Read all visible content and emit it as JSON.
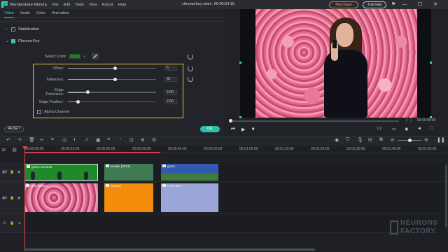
{
  "titlebar": {
    "app_name": "Wondershare Filmora",
    "menus": [
      "File",
      "Edit",
      "Tools",
      "View",
      "Export",
      "Help"
    ],
    "doc_title": "chroma-key-start : 00:00:54:15",
    "purchase_label": "Purchase",
    "tutorials_label": "Tutorials",
    "minimize": "—",
    "maximize": "☐",
    "close": "✕"
  },
  "editor": {
    "tabs": [
      "Video",
      "Audio",
      "Color",
      "Animation"
    ],
    "active_tab": "Video",
    "stabilization_label": "Stabilization",
    "chroma_key_label": "Chroma Key",
    "chroma_key_enabled": true,
    "select_color_label": "Select Color:",
    "selected_color": "#0d8a16",
    "sliders": [
      {
        "label": "Offset:",
        "value": "6",
        "fraction": 0.53
      },
      {
        "label": "Tolerance:",
        "value": "31",
        "fraction": 0.53
      },
      {
        "label": "Edge Thickness:",
        "value": "2.00",
        "fraction": 0.22
      },
      {
        "label": "Edge Feather:",
        "value": "2.00",
        "fraction": 0.11
      }
    ],
    "alpha_channel_label": "Alpha Channel",
    "reset_label": "RESET",
    "ok_label": "OK"
  },
  "preview": {
    "time": "00:00:00:00",
    "ratio": "1/2",
    "controls": [
      "⏮",
      "▶",
      "⏹"
    ]
  },
  "timeline": {
    "ruler": [
      "00:00:00:00",
      "00:00:10:00",
      "00:00:20:00",
      "00:00:30:00",
      "00:00:40:00",
      "00:00:50:00",
      "00:01:00:00",
      "00:01:10:00",
      "00:01:20:00",
      "00:01:30:00",
      "00:01:40:00",
      "00:01:50:00"
    ],
    "track2_clips": [
      {
        "label": "green SSA015",
        "color": "#1f8a2a"
      },
      {
        "label": "people (6813)",
        "color": "#3f7a55"
      },
      {
        "label": "grass",
        "color": "#2f5ab0"
      }
    ],
    "track1_clips": [
      {
        "label": "pink flowers",
        "color": "#d35b86"
      },
      {
        "label": "Orange",
        "color": "#f28c0a"
      },
      {
        "label": "Haze blue",
        "color": "#9aa6d8"
      }
    ]
  },
  "watermark": {
    "line1": "NEURONS",
    "line2": "FACTORY"
  }
}
